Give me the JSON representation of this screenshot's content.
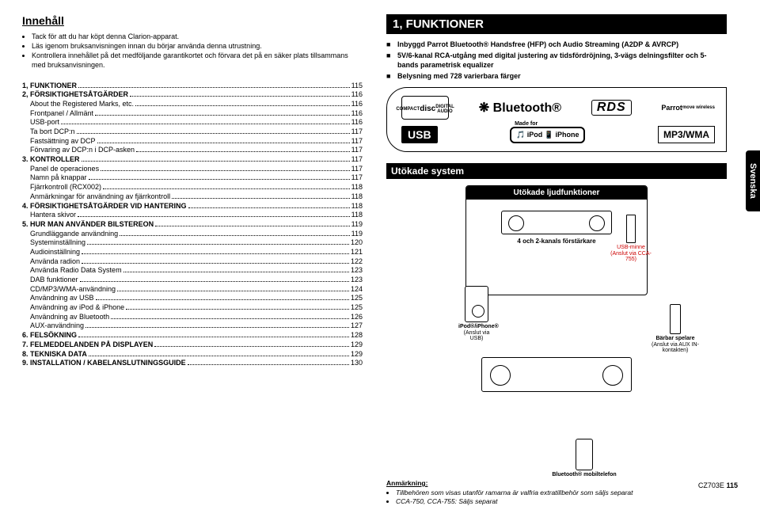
{
  "header": {
    "title": "Innehåll",
    "intro": [
      "Tack för att du har köpt denna Clarion-apparat.",
      "Läs igenom bruksanvisningen innan du börjar använda denna utrustning.",
      "Kontrollera innehållet på det medföljande garantikortet och förvara det på en säker plats tillsammans med bruksanvisningen."
    ]
  },
  "toc": [
    {
      "label": "1, FUNKTIONER",
      "page": "115",
      "bold": true
    },
    {
      "label": "2, FÖRSIKTIGHETSÅTGÄRDER",
      "page": "116",
      "bold": true
    },
    {
      "label": "About the Registered Marks, etc.",
      "page": "116",
      "sub": true
    },
    {
      "label": "Frontpanel / Allmänt",
      "page": "116",
      "sub": true
    },
    {
      "label": "USB-port",
      "page": "116",
      "sub": true
    },
    {
      "label": "Ta bort DCP:n",
      "page": "117",
      "sub": true
    },
    {
      "label": "Fastsättning av DCP",
      "page": "117",
      "sub": true
    },
    {
      "label": "Förvaring av DCP:n i DCP-asken",
      "page": "117",
      "sub": true
    },
    {
      "label": "3. KONTROLLER",
      "page": "117",
      "bold": true
    },
    {
      "label": "Panel de operaciones",
      "page": "117",
      "sub": true
    },
    {
      "label": "Namn på knappar",
      "page": "117",
      "sub": true
    },
    {
      "label": "Fjärrkontroll (RCX002)",
      "page": "118",
      "sub": true
    },
    {
      "label": "Anmärkningar för användning av fjärrkontroll",
      "page": "118",
      "sub": true
    },
    {
      "label": "4. FÖRSIKTIGHETSÅTGÄRDER VID HANTERING",
      "page": "118",
      "bold": true
    },
    {
      "label": "Hantera skivor",
      "page": "118",
      "sub": true
    },
    {
      "label": "5. HUR MAN ANVÄNDER BILSTEREON",
      "page": "119",
      "bold": true
    },
    {
      "label": "Grundläggande användning",
      "page": "119",
      "sub": true
    },
    {
      "label": "Systeminställning",
      "page": "120",
      "sub": true
    },
    {
      "label": "Audioinställning",
      "page": "121",
      "sub": true
    },
    {
      "label": "Använda radion",
      "page": "122",
      "sub": true
    },
    {
      "label": "Använda Radio Data System",
      "page": "123",
      "sub": true
    },
    {
      "label": "DAB funktioner",
      "page": "123",
      "sub": true
    },
    {
      "label": "CD/MP3/WMA-användning",
      "page": "124",
      "sub": true
    },
    {
      "label": "Användning av USB",
      "page": "125",
      "sub": true
    },
    {
      "label": "Användning av iPod & iPhone",
      "page": "125",
      "sub": true
    },
    {
      "label": "Användning av Bluetooth",
      "page": "126",
      "sub": true
    },
    {
      "label": "AUX-användning",
      "page": "127",
      "sub": true
    },
    {
      "label": "6. FELSÖKNING",
      "page": "128",
      "bold": true
    },
    {
      "label": "7. FELMEDDELANDEN PÅ DISPLAYEN",
      "page": "129",
      "bold": true
    },
    {
      "label": "8. TEKNISKA DATA",
      "page": "129",
      "bold": true
    },
    {
      "label": "9. INSTALLATION / KABELANSLUTNINGSGUIDE",
      "page": "130",
      "bold": true
    }
  ],
  "section1": {
    "heading": "1, FUNKTIONER",
    "features": [
      "Inbyggd Parrot Bluetooth® Handsfree (HFP) och Audio Streaming (A2DP & AVRCP)",
      "5V/6-kanal RCA-utgång med digital justering av tidsfördröjning, 3-vägs delningsfilter och 5-bands parametrisk equalizer",
      "Belysning med 728 varierbara färger"
    ],
    "logos": {
      "cd_top": "COMPACT",
      "cd_mid": "disc",
      "cd_bottom": "DIGITAL AUDIO",
      "bluetooth": "❋ Bluetooth®",
      "rds": "RDS",
      "parrot": "Parrot",
      "parrot_sub": "move wireless",
      "usb": "USB",
      "ipod_made": "Made for",
      "ipod": "🎵 iPod  📱 iPhone",
      "mp3": "MP3/WMA"
    },
    "expand_heading": "Utökade system",
    "expand_sub": "Utökade ljudfunktioner",
    "amp": "4 och 2-kanals förstärkare",
    "ipod_caption_1": "iPod®/iPhone®",
    "ipod_caption_2": "(Anslut via USB)",
    "usb_caption_1": "USB-minne",
    "usb_caption_2": "(Anslut via CCA-755)",
    "barbar_1": "Bärbar spelare",
    "barbar_2": "(Anslut via AUX IN-kontakten)",
    "bt_phone": "Bluetooth® mobiltelefon"
  },
  "side_tab": "Svenska",
  "ann": {
    "heading": "Anmärkning:",
    "items": [
      "Tillbehören som visas utanför ramarna är valfria extratillbehör som säljs separat",
      "CCA-750, CCA-755: Säljs separat"
    ]
  },
  "footer": {
    "model": "CZ703E",
    "page": "115"
  }
}
